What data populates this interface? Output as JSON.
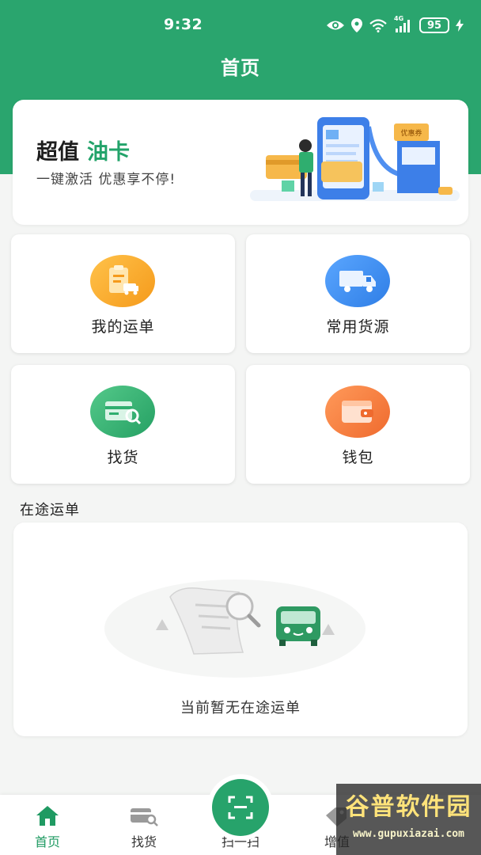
{
  "status_bar": {
    "time": "9:32",
    "network_label": "4G",
    "battery": "95",
    "icons": [
      "eye-icon",
      "location-icon",
      "wifi-icon",
      "signal-icon",
      "battery-icon",
      "charging-icon"
    ]
  },
  "header": {
    "title": "首页"
  },
  "banner": {
    "title_main": "超值",
    "title_accent": "油卡",
    "subtitle": "一键激活 优惠享不停!",
    "coupon_text": "优惠券"
  },
  "tiles": [
    {
      "label": "我的运单",
      "icon": "clipboard-truck-icon",
      "color": "#f5a623"
    },
    {
      "label": "常用货源",
      "icon": "truck-icon",
      "color": "#3e8ef1"
    },
    {
      "label": "找货",
      "icon": "card-search-icon",
      "color": "#2fae6f"
    },
    {
      "label": "钱包",
      "icon": "wallet-icon",
      "color": "#f0743a"
    }
  ],
  "section": {
    "title": "在途运单"
  },
  "empty_state": {
    "text": "当前暂无在途运单"
  },
  "tabbar": {
    "items": [
      {
        "label": "首页",
        "icon": "home-icon",
        "active": true
      },
      {
        "label": "找货",
        "icon": "card-search-icon"
      },
      {
        "label": "扫一扫",
        "icon": "scan-icon"
      },
      {
        "label": "增值",
        "icon": "value-added-icon"
      }
    ]
  },
  "watermark": {
    "title": "谷普软件园",
    "url": "www.gupuxiazai.com"
  },
  "colors": {
    "brand_green": "#2aa56e",
    "accent_green": "#22a36a"
  }
}
